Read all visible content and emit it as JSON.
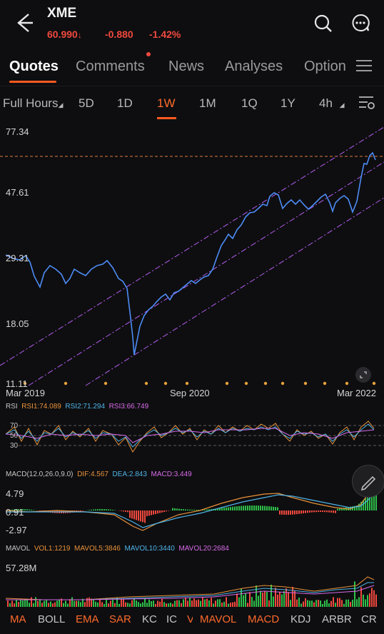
{
  "header": {
    "symbol": "XME",
    "price": "60.990",
    "change": "-0.880",
    "change_pct": "-1.42%"
  },
  "tabs": [
    {
      "label": "Quotes",
      "active": true
    },
    {
      "label": "Comments",
      "badge": true
    },
    {
      "label": "News"
    },
    {
      "label": "Analyses"
    },
    {
      "label": "Option"
    }
  ],
  "periods": [
    {
      "label": "Full Hours"
    },
    {
      "label": "5D"
    },
    {
      "label": "1D"
    },
    {
      "label": "1W",
      "active": true
    },
    {
      "label": "1M"
    },
    {
      "label": "1Q"
    },
    {
      "label": "1Y"
    },
    {
      "label": "4h"
    }
  ],
  "main_chart": {
    "y_labels": [
      "77.34",
      "47.61",
      "29.31",
      "18.05",
      "11.11"
    ],
    "x_labels": [
      "Mar 2019",
      "Sep 2020",
      "Mar 2022"
    ]
  },
  "rsi": {
    "title": "RSI",
    "rsi1": "RSI1:74.089",
    "rsi2": "RSI2:71.294",
    "rsi3": "RSI3:66.749",
    "levels": [
      "70",
      "50",
      "30"
    ]
  },
  "macd": {
    "title": "MACD(12.0,26.0,9.0)",
    "dif": "DIF:4.567",
    "dea": "DEA:2.843",
    "macd": "MACD:3.449",
    "y_labels": [
      "4.79",
      "0.91",
      "-2.97"
    ]
  },
  "mavol": {
    "title": "MAVOL",
    "vol1": "VOL1:1219",
    "mavol5": "MAVOL5:3846",
    "mavol10": "MAVOL10:3440",
    "mavol20": "MAVOL20:2684",
    "y_label": "57.28M"
  },
  "indicators": [
    {
      "label": "MA",
      "hi": true
    },
    {
      "label": "BOLL"
    },
    {
      "label": "EMA",
      "hi": true
    },
    {
      "label": "SAR",
      "hi": true
    },
    {
      "label": "KC"
    },
    {
      "label": "IC"
    },
    {
      "label": "V"
    },
    {
      "label": "MAVOL",
      "hi": true
    },
    {
      "label": "MACD",
      "hi": true
    },
    {
      "label": "KDJ"
    },
    {
      "label": "ARBR"
    },
    {
      "label": "CR"
    }
  ],
  "colors": {
    "up": "#f0493e",
    "down": "#2fbf4a",
    "accent": "#ff5a1f",
    "price_line": "#4d8cf5",
    "channel": "#b45cf0"
  },
  "icons": [
    "back-arrow-icon",
    "search-icon",
    "more-icon",
    "menu-icon",
    "chart-settings-icon",
    "expand-icon",
    "pencil-icon"
  ]
}
